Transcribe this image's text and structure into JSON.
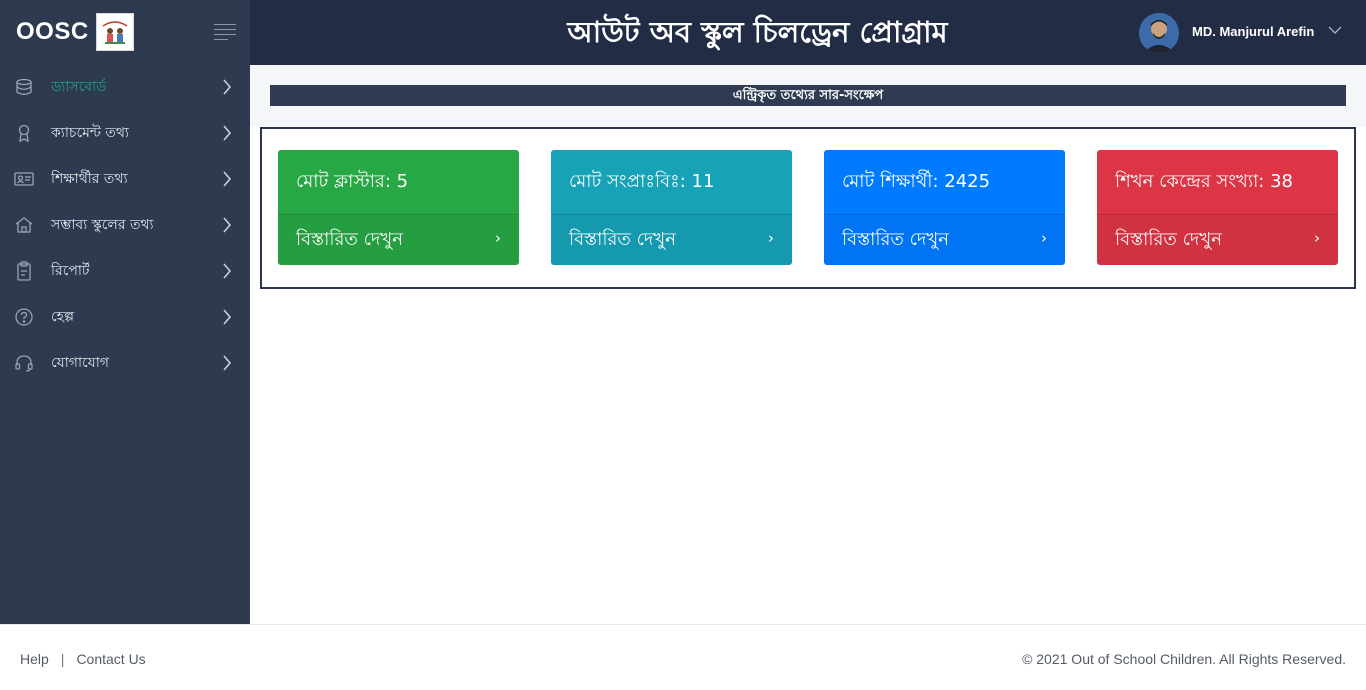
{
  "brand": {
    "name": "OOSC",
    "logo_icon": "oosc-logo"
  },
  "header": {
    "title": "আউট অব স্কুল চিলড্রেন প্রোগ্রাম"
  },
  "user": {
    "name": "MD. Manjurul Arefin"
  },
  "sidebar": {
    "items": [
      {
        "label": "ড্যাসবোর্ড",
        "icon": "database-icon",
        "active": true
      },
      {
        "label": "ক্যাচমেন্ট তথ্য",
        "icon": "award-icon",
        "active": false
      },
      {
        "label": "শিক্ষার্থীর তথ্য",
        "icon": "id-card-icon",
        "active": false
      },
      {
        "label": "সম্ভাব্য স্কুলের তথ্য",
        "icon": "school-icon",
        "active": false
      },
      {
        "label": "রিপোর্ট",
        "icon": "clipboard-icon",
        "active": false
      },
      {
        "label": "হেল্প",
        "icon": "help-icon",
        "active": false
      },
      {
        "label": "যোগাযোগ",
        "icon": "headset-icon",
        "active": false
      }
    ]
  },
  "summary": {
    "title": "এন্ট্রিকৃত তথ্যের সার-সংক্ষেপ",
    "cards": [
      {
        "label": "মোট ক্লাস্টার: 5",
        "link": "বিস্তারিত দেখুন",
        "color": "#28a745"
      },
      {
        "label": "মোট সংপ্রাঃবিঃ: 11",
        "link": "বিস্তারিত দেখুন",
        "color": "#17a2b8"
      },
      {
        "label": "মোট শিক্ষার্থী: 2425",
        "link": "বিস্তারিত দেখুন",
        "color": "#007bff"
      },
      {
        "label": "শিখন কেন্দ্রের সংখ্যা: 38",
        "link": "বিস্তারিত দেখুন",
        "color": "#dc3545"
      }
    ]
  },
  "footer": {
    "help": "Help",
    "separator": "|",
    "contact": "Contact Us",
    "copyright": "© 2021 Out of School Children. All Rights Reserved."
  },
  "colors": {
    "sidebar_bg": "#2e3a50",
    "topbar_bg": "#222d45",
    "active_menu": "#1fa38f"
  }
}
